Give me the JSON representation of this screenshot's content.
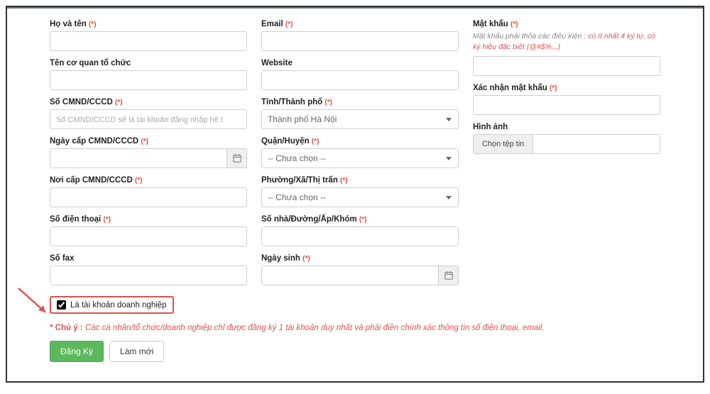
{
  "col1": {
    "ho_ten": {
      "label": "Họ và tên",
      "required": "(*)"
    },
    "ten_co_quan": {
      "label": "Tên cơ quan tổ chức"
    },
    "cmnd": {
      "label": "Số CMND/CCCD",
      "required": "(*)",
      "placeholder": "Số CMND/CCCD sẽ là tài khoản đăng nhập hệ t"
    },
    "ngay_cap": {
      "label": "Ngày cấp CMND/CCCD",
      "required": "(*)"
    },
    "noi_cap": {
      "label": "Nơi cấp CMND/CCCD",
      "required": "(*)"
    },
    "dien_thoai": {
      "label": "Số điện thoại",
      "required": "(*)"
    },
    "fax": {
      "label": "Số fax"
    },
    "checkbox": {
      "label": "Là tài khoản doanh nghiệp"
    }
  },
  "col2": {
    "email": {
      "label": "Email",
      "required": "(*)"
    },
    "website": {
      "label": "Website"
    },
    "tinh": {
      "label": "Tỉnh/Thành phố",
      "required": "(*)",
      "value": "Thành phố Hà Nội"
    },
    "quan": {
      "label": "Quận/Huyện",
      "required": "(*)",
      "value": "-- Chưa chọn --"
    },
    "phuong": {
      "label": "Phường/Xã/Thị trấn",
      "required": "(*)",
      "value": "-- Chưa chọn --"
    },
    "so_nha": {
      "label": "Số nhà/Đường/Ấp/Khóm",
      "required": "(*)"
    },
    "ngay_sinh": {
      "label": "Ngày sinh",
      "required": "(*)"
    }
  },
  "col3": {
    "mat_khau": {
      "label": "Mật khẩu",
      "required": "(*)",
      "hint_pre": "Mật khẩu phải thỏa các điều kiện : ",
      "hint_red": "có ít nhất 4 ký tự, có ký hiệu đặc biệt (@#$%...)"
    },
    "xac_nhan": {
      "label": "Xác nhận mật khẩu",
      "required": "(*)"
    },
    "hinh_anh": {
      "label": "Hình ảnh",
      "btn": "Chọn tệp tin"
    }
  },
  "note": {
    "prefix": "* Chú ý :",
    "text": " Các cá nhân/tổ chức/doanh nghiệp chỉ được đăng ký 1 tài khoản duy nhất và phải điền chính xác thông tin số điện thoại, email."
  },
  "buttons": {
    "submit": "Đăng Ký",
    "reset": "Làm mới"
  }
}
